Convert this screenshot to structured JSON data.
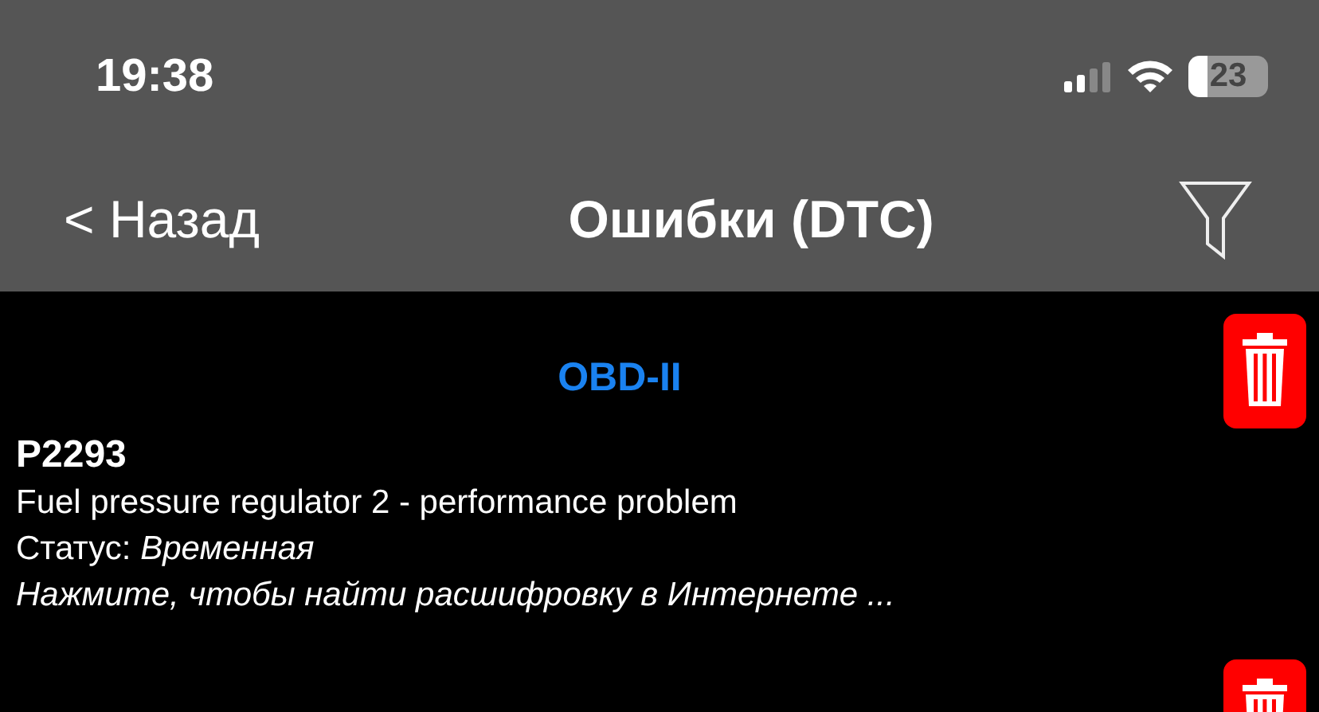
{
  "status_bar": {
    "time": "19:38",
    "battery": "23"
  },
  "nav": {
    "back": "< Назад",
    "title": "Ошибки (DTC)"
  },
  "sections": [
    {
      "title": "OBD-II",
      "entries": [
        {
          "code": "P2293",
          "description": "Fuel pressure regulator 2 - performance problem",
          "status": "Статус: *Временная*",
          "hint": "Нажмите, чтобы найти расшифровку в Интернете ..."
        }
      ]
    }
  ]
}
